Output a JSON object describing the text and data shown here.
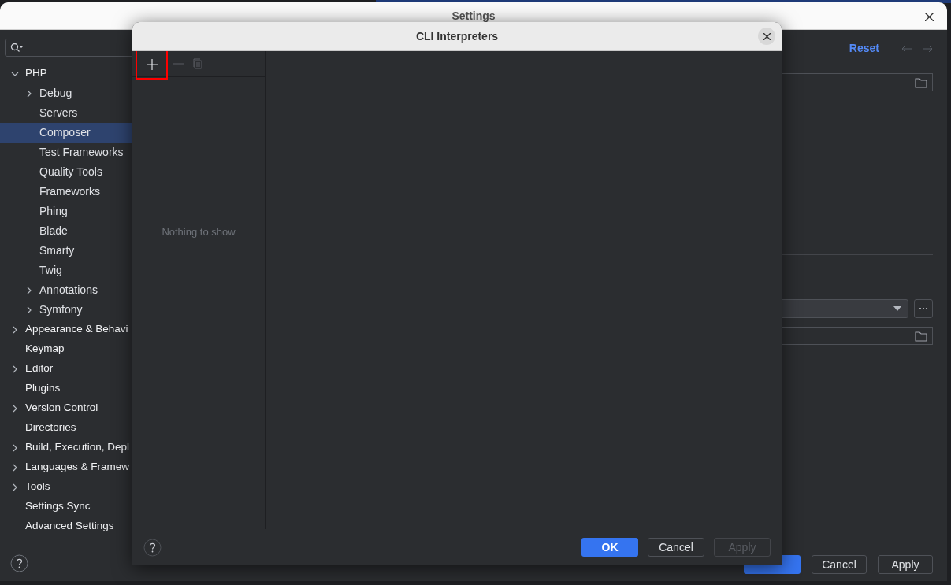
{
  "settings_window": {
    "title": "Settings",
    "sidebar": {
      "items": [
        {
          "label": "PHP",
          "expanded": true,
          "selected": false,
          "children": [
            {
              "label": "Debug",
              "expanded": false,
              "selected": false
            },
            {
              "label": "Servers",
              "selected": false
            },
            {
              "label": "Composer",
              "selected": true
            },
            {
              "label": "Test Frameworks",
              "selected": false
            },
            {
              "label": "Quality Tools",
              "selected": false
            },
            {
              "label": "Frameworks",
              "selected": false
            },
            {
              "label": "Phing",
              "selected": false
            },
            {
              "label": "Blade",
              "selected": false
            },
            {
              "label": "Smarty",
              "selected": false
            },
            {
              "label": "Twig",
              "selected": false
            },
            {
              "label": "Annotations",
              "expanded": false,
              "selected": false
            },
            {
              "label": "Symfony",
              "expanded": false,
              "selected": false
            }
          ]
        },
        {
          "label": "Appearance & Behavi",
          "expanded": false,
          "selected": false
        },
        {
          "label": "Keymap",
          "selected": false
        },
        {
          "label": "Editor",
          "expanded": false,
          "selected": false
        },
        {
          "label": "Plugins",
          "selected": false
        },
        {
          "label": "Version Control",
          "expanded": false,
          "selected": false
        },
        {
          "label": "Directories",
          "selected": false
        },
        {
          "label": "Build, Execution, Depl",
          "expanded": false,
          "selected": false
        },
        {
          "label": "Languages & Framew",
          "expanded": false,
          "selected": false
        },
        {
          "label": "Tools",
          "expanded": false,
          "selected": false
        },
        {
          "label": "Settings Sync",
          "selected": false
        },
        {
          "label": "Advanced Settings",
          "selected": false
        }
      ]
    },
    "header": {
      "reset_link": "Reset"
    },
    "buttons": [
      {
        "label": "Cancel",
        "disabled": false
      },
      {
        "label": "Apply",
        "disabled": false
      }
    ]
  },
  "dialog": {
    "title": "CLI Interpreters",
    "toolbar": [
      {
        "kind": "add",
        "disabled": false,
        "highlighted": true
      },
      {
        "kind": "remove",
        "disabled": true,
        "highlighted": false
      },
      {
        "kind": "copy",
        "disabled": true,
        "highlighted": false
      }
    ],
    "empty_text": "Nothing to show",
    "buttons": [
      {
        "label": "OK",
        "kind": "primary",
        "disabled": false
      },
      {
        "label": "Cancel",
        "kind": "normal",
        "disabled": false
      },
      {
        "label": "Apply",
        "kind": "normal",
        "disabled": true
      }
    ]
  }
}
